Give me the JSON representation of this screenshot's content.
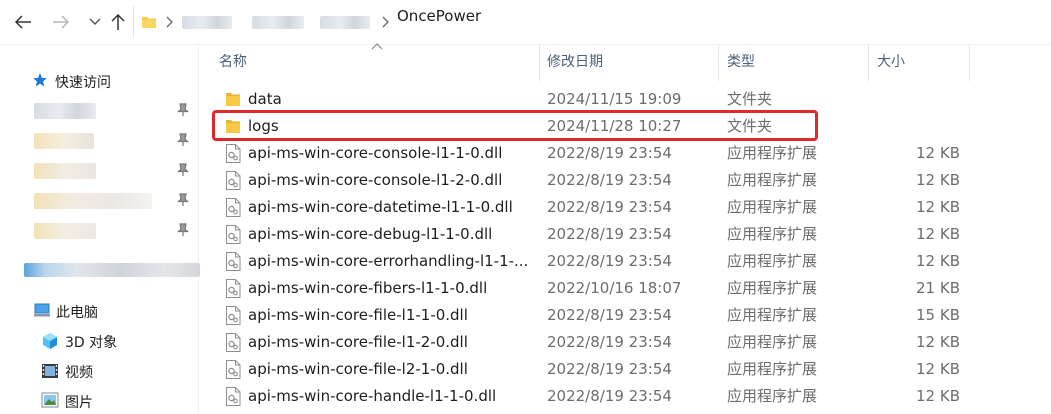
{
  "address_bar": {
    "current_folder": "OncePower"
  },
  "sidebar": {
    "quick_access_label": "快速访问",
    "this_pc_label": "此电脑",
    "items": [
      {
        "label": "3D 对象",
        "icon": "3d-objects-icon"
      },
      {
        "label": "视频",
        "icon": "videos-icon"
      },
      {
        "label": "图片",
        "icon": "pictures-icon"
      }
    ]
  },
  "columns": {
    "name": "名称",
    "date": "修改日期",
    "type": "类型",
    "size": "大小"
  },
  "files": [
    {
      "name": "data",
      "date": "2024/11/15 19:09",
      "type": "文件夹",
      "size": "",
      "kind": "folder"
    },
    {
      "name": "logs",
      "date": "2024/11/28 10:27",
      "type": "文件夹",
      "size": "",
      "kind": "folder",
      "highlighted": true
    },
    {
      "name": "api-ms-win-core-console-l1-1-0.dll",
      "date": "2022/8/19 23:54",
      "type": "应用程序扩展",
      "size": "12 KB",
      "kind": "dll"
    },
    {
      "name": "api-ms-win-core-console-l1-2-0.dll",
      "date": "2022/8/19 23:54",
      "type": "应用程序扩展",
      "size": "12 KB",
      "kind": "dll"
    },
    {
      "name": "api-ms-win-core-datetime-l1-1-0.dll",
      "date": "2022/8/19 23:54",
      "type": "应用程序扩展",
      "size": "12 KB",
      "kind": "dll"
    },
    {
      "name": "api-ms-win-core-debug-l1-1-0.dll",
      "date": "2022/8/19 23:54",
      "type": "应用程序扩展",
      "size": "12 KB",
      "kind": "dll"
    },
    {
      "name": "api-ms-win-core-errorhandling-l1-1-...",
      "date": "2022/8/19 23:54",
      "type": "应用程序扩展",
      "size": "12 KB",
      "kind": "dll"
    },
    {
      "name": "api-ms-win-core-fibers-l1-1-0.dll",
      "date": "2022/10/16 18:07",
      "type": "应用程序扩展",
      "size": "21 KB",
      "kind": "dll"
    },
    {
      "name": "api-ms-win-core-file-l1-1-0.dll",
      "date": "2022/8/19 23:54",
      "type": "应用程序扩展",
      "size": "15 KB",
      "kind": "dll"
    },
    {
      "name": "api-ms-win-core-file-l1-2-0.dll",
      "date": "2022/8/19 23:54",
      "type": "应用程序扩展",
      "size": "12 KB",
      "kind": "dll"
    },
    {
      "name": "api-ms-win-core-file-l2-1-0.dll",
      "date": "2022/8/19 23:54",
      "type": "应用程序扩展",
      "size": "12 KB",
      "kind": "dll"
    },
    {
      "name": "api-ms-win-core-handle-l1-1-0.dll",
      "date": "2022/8/19 23:54",
      "type": "应用程序扩展",
      "size": "12 KB",
      "kind": "dll"
    }
  ],
  "colors": {
    "highlight_border": "#e02a2a",
    "folder_yellow": "#f8c945",
    "header_text": "#4c607a"
  }
}
